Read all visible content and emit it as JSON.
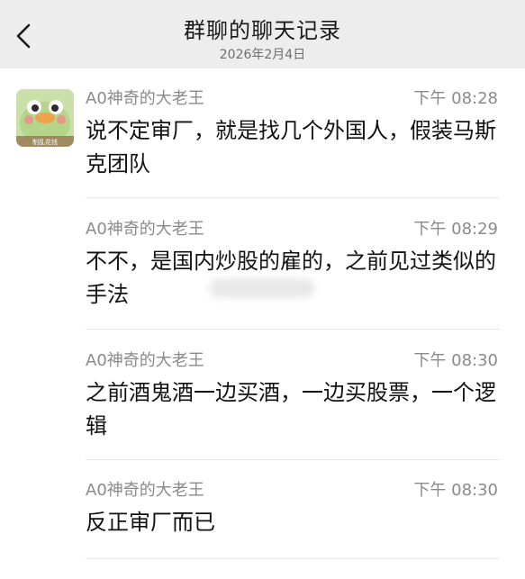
{
  "header": {
    "title": "群聊的聊天记录",
    "date": "2026年2月4日",
    "back_icon": "chevron-left-icon"
  },
  "messages": [
    {
      "sender": "A0神奇的大老王",
      "time": "下午 08:28",
      "text": "说不定审厂，就是找几个外国人，假装马斯克团队",
      "show_avatar": true
    },
    {
      "sender": "A0神奇的大老王",
      "time": "下午 08:29",
      "text": "不不，是国内炒股的雇的，之前见过类似的手法",
      "show_avatar": false
    },
    {
      "sender": "A0神奇的大老王",
      "time": "下午 08:30",
      "text": "之前酒鬼酒一边买酒，一边买股票，一个逻辑",
      "show_avatar": false
    },
    {
      "sender": "A0神奇的大老王",
      "time": "下午 08:30",
      "text": "反正审厂而已",
      "show_avatar": false
    }
  ],
  "avatar": {
    "caption": "制乱花钱",
    "icon": "duck-avatar-icon",
    "background": "#c9e0a9"
  },
  "colors": {
    "header_bg": "#ededed",
    "meta_text": "#8a8a8a",
    "message_text": "#121212",
    "divider": "#e6e6e6"
  }
}
